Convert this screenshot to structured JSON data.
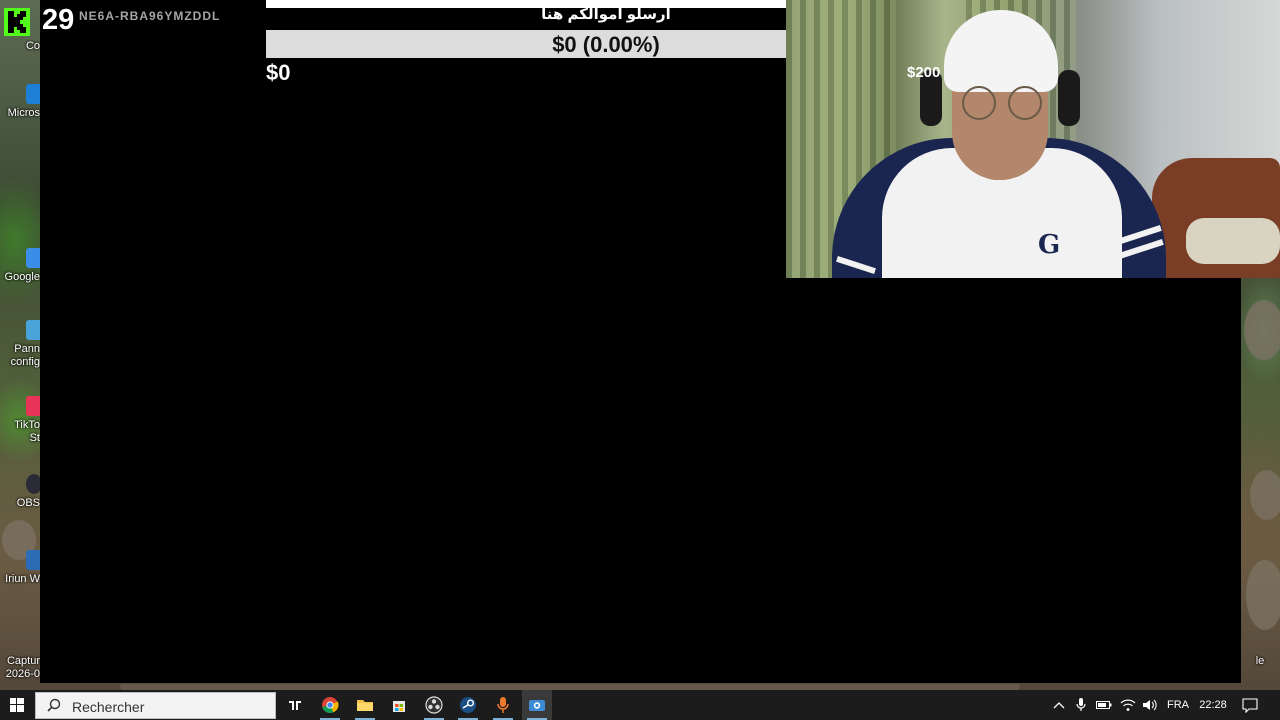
{
  "stream_overlay": {
    "viewer_count": "29",
    "stream_key": "NE6A-RBA96YMZDDL",
    "goal": {
      "prompt_text": "ارسلو اموالكم هنا",
      "current_display": "$0 (0.00%)",
      "progress_percent": 0,
      "min_label": "$0",
      "max_label": "$200",
      "fill_color": "#53fc18"
    },
    "brand_color": "#53fc18"
  },
  "desktop_icons": [
    {
      "label": "Co",
      "icon": "app-icon"
    },
    {
      "label": "Micros",
      "icon": "edge-icon"
    },
    {
      "label": "Google",
      "icon": "chrome-icon"
    },
    {
      "label": "Pann",
      "icon": "control-panel-icon"
    },
    {
      "label": "config",
      "icon": "control-panel-icon"
    },
    {
      "label": "TikTo",
      "icon": "tiktok-icon"
    },
    {
      "label": "St",
      "icon": "tiktok-icon"
    },
    {
      "label": "OBS",
      "icon": "obs-icon"
    },
    {
      "label": "Iriun W",
      "icon": "iriun-icon"
    },
    {
      "label": "Captur",
      "icon": "capture-icon"
    },
    {
      "label": "2026-0",
      "icon": "capture-icon"
    }
  ],
  "desktop_icon_right": {
    "label": "le"
  },
  "taskbar": {
    "search_placeholder": "Rechercher",
    "apps": [
      {
        "name": "tiktok",
        "icon": "tiktok-icon"
      },
      {
        "name": "chrome",
        "icon": "chrome-icon"
      },
      {
        "name": "explorer",
        "icon": "folder-icon"
      },
      {
        "name": "store",
        "icon": "store-icon"
      },
      {
        "name": "obs",
        "icon": "obs-icon"
      },
      {
        "name": "steam",
        "icon": "steam-icon"
      },
      {
        "name": "recorder",
        "icon": "microphone-app-icon"
      },
      {
        "name": "iriun",
        "icon": "iriun-icon"
      }
    ],
    "tray": {
      "language": "FRA",
      "time": "22:28"
    }
  }
}
